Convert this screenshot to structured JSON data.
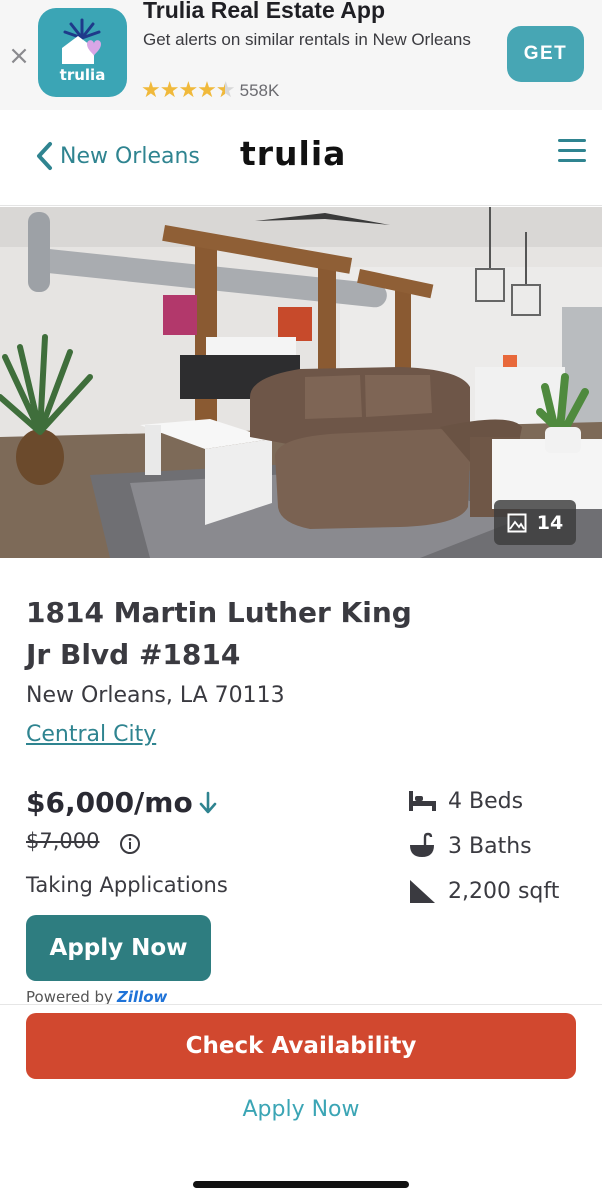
{
  "app_banner": {
    "close_icon": "close-icon",
    "app_icon_text": "trulia",
    "title": "Trulia Real Estate App",
    "subtitle": "Get alerts on similar rentals in New Orleans",
    "rating_stars": 4.5,
    "rating_count": "558K",
    "get_label": "GET",
    "star_color": "#f0b93b",
    "accent": "#47a6b4"
  },
  "header": {
    "back_label": "New Orleans",
    "back_icon": "chevron-left-icon",
    "logo": "trulia",
    "menu_icon": "hamburger-menu-icon",
    "accent": "#2f8490"
  },
  "photo": {
    "count": "14",
    "count_icon": "image-icon"
  },
  "listing": {
    "address_line1": "1814 Martin Luther King",
    "address_line2": "Jr Blvd #1814",
    "city_state_zip": "New Orleans, LA 70113",
    "neighborhood": "Central City",
    "price": "$6,000/mo",
    "price_trend_icon": "arrow-down-icon",
    "previous_price": "$7,000",
    "status": "Taking Applications",
    "apply_label": "Apply Now",
    "powered_by": "Powered by",
    "powered_brand": "Zillow",
    "facts": [
      {
        "icon": "bed-icon",
        "label": "4 Beds"
      },
      {
        "icon": "bath-icon",
        "label": "3 Baths"
      },
      {
        "icon": "area-icon",
        "label": "2,200 sqft"
      }
    ]
  },
  "footer": {
    "check_availability_label": "Check Availability",
    "apply_now_label": "Apply Now",
    "primary_color": "#d1482f",
    "apply_button_color": "#2e7d80"
  }
}
